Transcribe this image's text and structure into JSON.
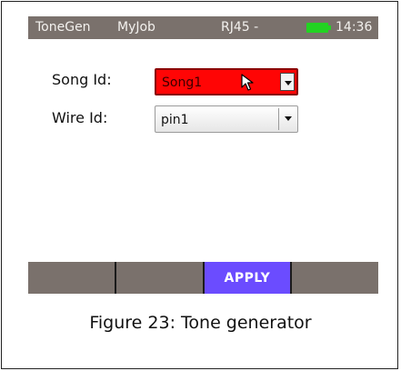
{
  "statusbar": {
    "app": "ToneGen",
    "job": "MyJob",
    "connection": "RJ45 -",
    "time": "14:36",
    "battery_color": "#22d322"
  },
  "form": {
    "song_label": "Song Id:",
    "song_value": "Song1",
    "wire_label": "Wire Id:",
    "wire_value": "pin1"
  },
  "softkeys": [
    "",
    "",
    "APPLY",
    ""
  ],
  "caption": "Figure 23: Tone generator",
  "colors": {
    "statusbar_bg": "#7a716c",
    "song_highlight": "#ff0505",
    "apply_bg": "#6b4cff"
  }
}
